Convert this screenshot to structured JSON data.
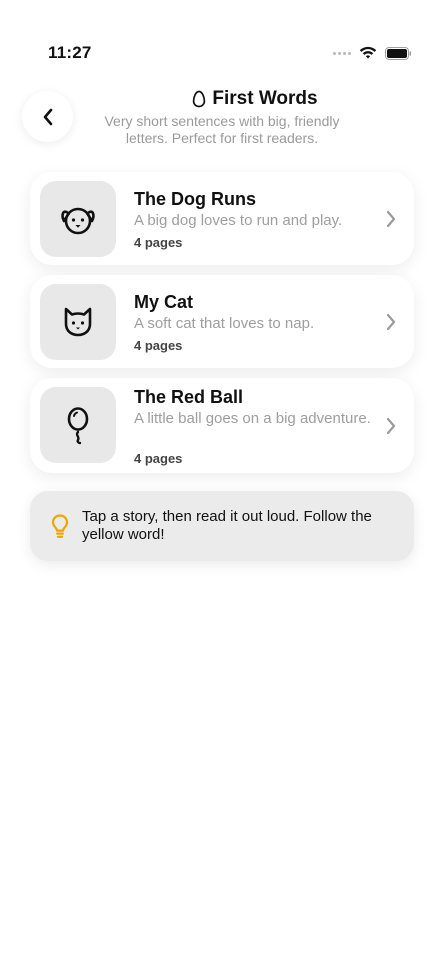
{
  "status_bar": {
    "time": "11:27"
  },
  "header": {
    "title": "First Words",
    "title_icon": "egg-icon",
    "subtitle": "Very short sentences with big, friendly letters. Perfect for first readers.",
    "back_icon": "chevron-left-icon"
  },
  "stories": [
    {
      "title": "The Dog Runs",
      "description": "A big dog loves to run and play.",
      "pages": "4 pages",
      "icon": "dog-icon"
    },
    {
      "title": "My Cat",
      "description": "A soft cat that loves to nap.",
      "pages": "4 pages",
      "icon": "cat-icon"
    },
    {
      "title": "The Red Ball",
      "description": "A little ball goes on a big adventure.",
      "pages": "4 pages",
      "icon": "balloon-icon"
    }
  ],
  "tip": {
    "icon": "lightbulb-icon",
    "text": "Tap a story, then read it out loud. Follow the yellow word!"
  },
  "colors": {
    "background": "#ffffff",
    "card_icon_bg": "#e8e8e8",
    "tip_bg": "#ebebeb",
    "tip_icon": "#f0a500",
    "muted_text": "#9e9e9e"
  }
}
